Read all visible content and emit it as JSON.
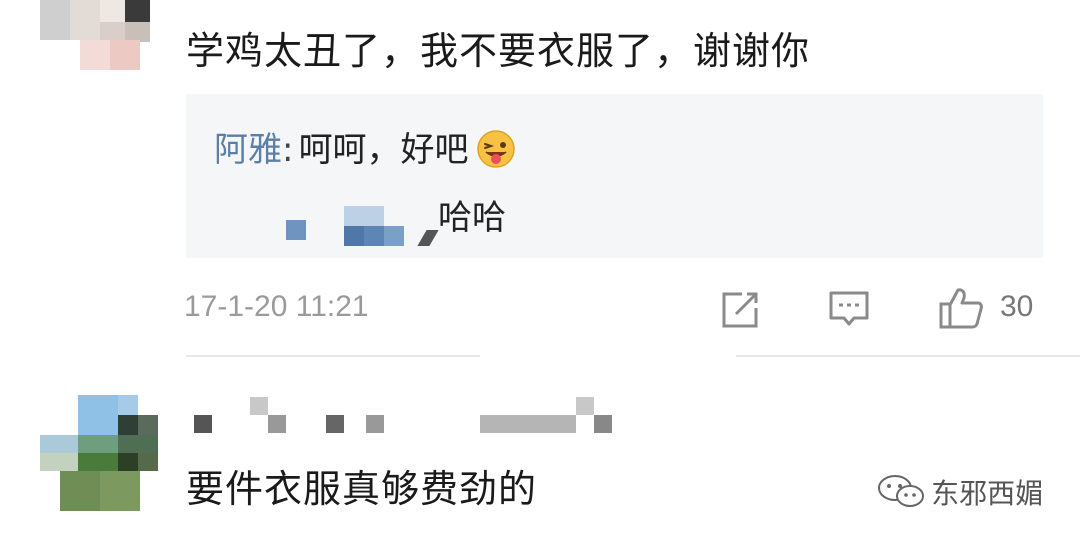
{
  "comment1": {
    "text": "学鸡太丑了，我不要衣服了，谢谢你",
    "reply": {
      "name": "阿雅",
      "separator": ":",
      "body": "呵呵，好吧",
      "emoji": "winking-tongue-emoji"
    },
    "reply2_text": "哈哈",
    "timestamp": "17-1-20 11:21",
    "like_count": "30"
  },
  "comment2": {
    "text": "要件衣服真够费劲的"
  },
  "watermark": {
    "label": "东邪西媚"
  },
  "colors": {
    "reply_name": "#5b7fa6",
    "reply_bg": "#f5f6f8",
    "muted": "#9a9a9a"
  }
}
